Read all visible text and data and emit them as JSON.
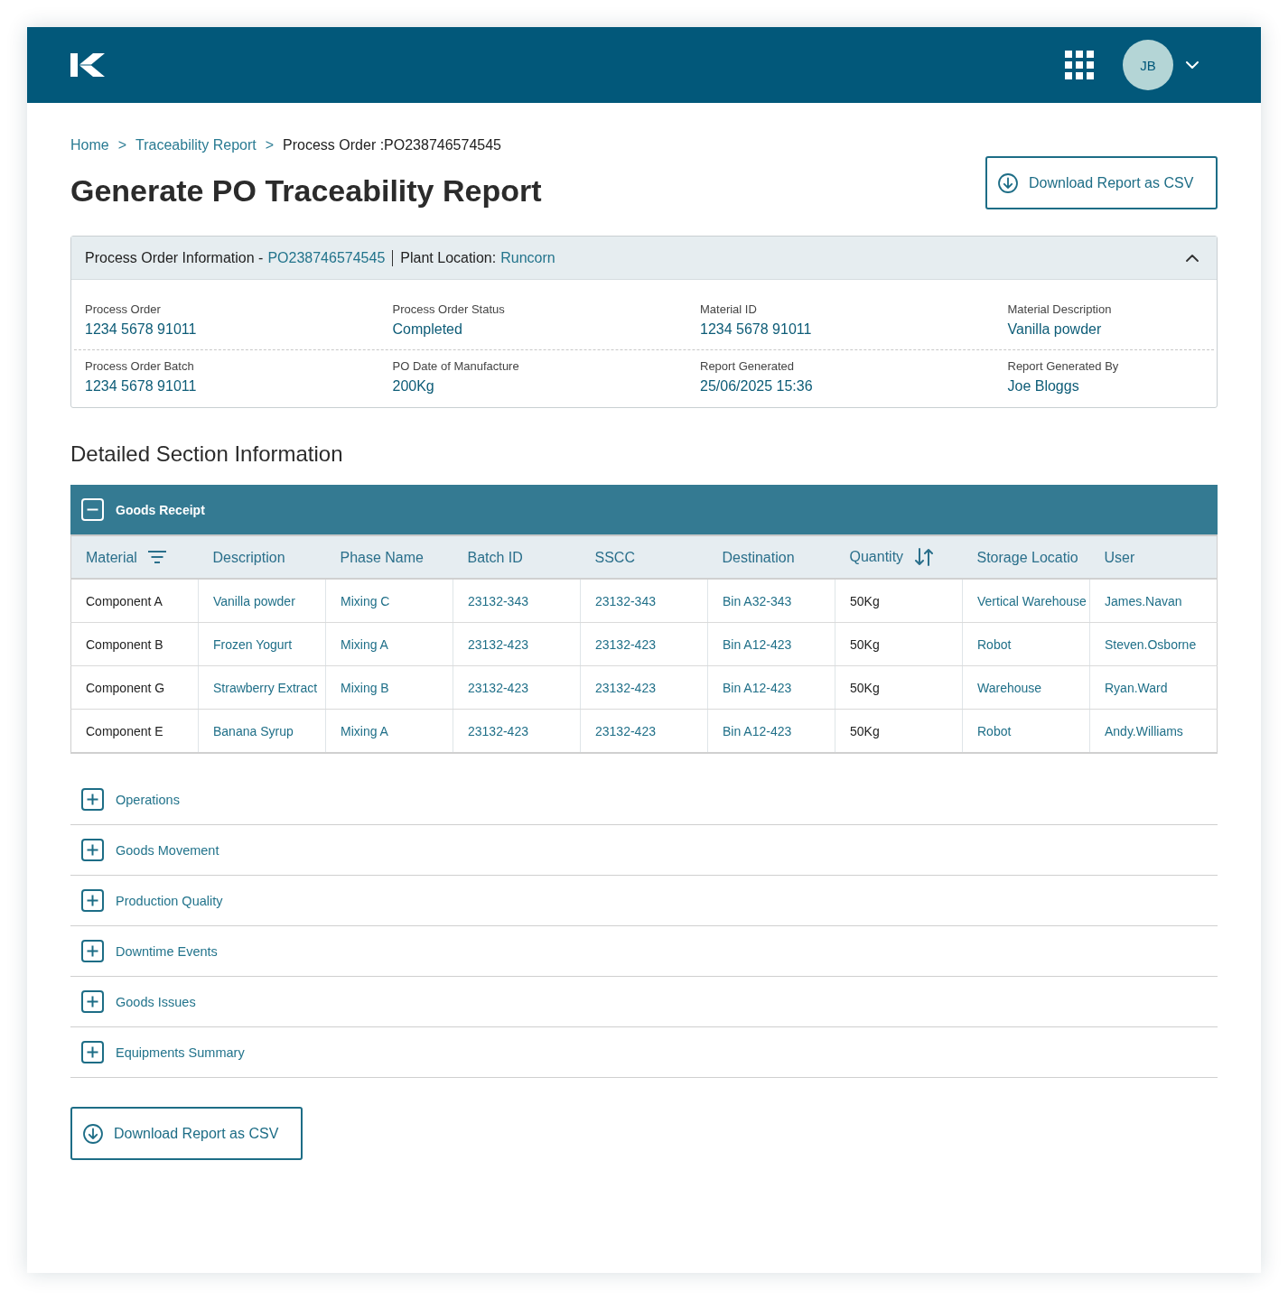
{
  "top_bar": {
    "user": {
      "initials": "JB"
    }
  },
  "breadcrumbs": [
    {
      "label": "Home",
      "separator": ">",
      "current": false
    },
    {
      "label": "Traceability Report",
      "separator": ">",
      "current": false
    },
    {
      "label": "Process Order :PO238746574545",
      "current": true
    }
  ],
  "page_title": "Generate PO Traceability Report",
  "top_action": {
    "label": "Download Report as CSV"
  },
  "info_panel": {
    "title": "Process Order Information -",
    "order_id": "PO238746574545",
    "location_label": "Plant Location:",
    "location": "Runcorn",
    "expanded": true,
    "fields": [
      {
        "label": "Process Order",
        "value": "1234 5678 91011"
      },
      {
        "label": "Process Order Status",
        "value": "Completed"
      },
      {
        "label": "Material ID",
        "value": "1234 5678 91011"
      },
      {
        "label": "Material Description",
        "value": "Vanilla powder"
      },
      {
        "label": "Process Order Batch",
        "value": "1234 5678 91011"
      },
      {
        "label": "PO Date of Manufacture",
        "value": "200Kg"
      },
      {
        "label": "Report Generated",
        "value": "25/06/2025 15:36"
      },
      {
        "label": "Report Generated By",
        "value": "Joe Bloggs"
      }
    ]
  },
  "sections_heading": "Detailed Section Information",
  "sections": [
    {
      "title": "Goods Receipt",
      "expanded": true,
      "table": {
        "columns": [
          {
            "label": "Material",
            "kind": "text",
            "filterable": true,
            "sortable": false
          },
          {
            "label": "Description",
            "kind": "link",
            "filterable": false,
            "sortable": false
          },
          {
            "label": "Phase Name",
            "kind": "link",
            "filterable": false,
            "sortable": false
          },
          {
            "label": "Batch ID",
            "kind": "link",
            "filterable": false,
            "sortable": false
          },
          {
            "label": "SSCC",
            "kind": "link",
            "filterable": false,
            "sortable": false
          },
          {
            "label": "Destination",
            "kind": "link",
            "filterable": false,
            "sortable": false
          },
          {
            "label": "Quantity",
            "kind": "text",
            "filterable": false,
            "sortable": true
          },
          {
            "label": "Storage Locatio",
            "kind": "link",
            "filterable": false,
            "sortable": false
          },
          {
            "label": "User",
            "kind": "link",
            "filterable": false,
            "sortable": false
          }
        ],
        "rows": [
          [
            "Component A",
            "Vanilla powder",
            "Mixing C",
            "23132-343",
            "23132-343",
            "Bin A32-343",
            "50Kg",
            "Vertical Warehouse",
            "James.Navan"
          ],
          [
            "Component B",
            "Frozen Yogurt",
            "Mixing A",
            "23132-423",
            "23132-423",
            "Bin A12-423",
            "50Kg",
            "Robot",
            "Steven.Osborne"
          ],
          [
            "Component G",
            "Strawberry Extract",
            "Mixing B",
            "23132-423",
            "23132-423",
            "Bin A12-423",
            "50Kg",
            "Warehouse",
            "Ryan.Ward"
          ],
          [
            "Component E",
            "Banana Syrup",
            "Mixing A",
            "23132-423",
            "23132-423",
            "Bin A12-423",
            "50Kg",
            "Robot",
            "Andy.Williams"
          ]
        ]
      }
    },
    {
      "title": "Operations",
      "expanded": false
    },
    {
      "title": "Goods Movement",
      "expanded": false
    },
    {
      "title": "Production Quality",
      "expanded": false
    },
    {
      "title": "Downtime Events",
      "expanded": false
    },
    {
      "title": "Goods Issues",
      "expanded": false
    },
    {
      "title": "Equipments Summary",
      "expanded": false
    }
  ],
  "bottom_action": {
    "label": "Download Report as CSV"
  }
}
